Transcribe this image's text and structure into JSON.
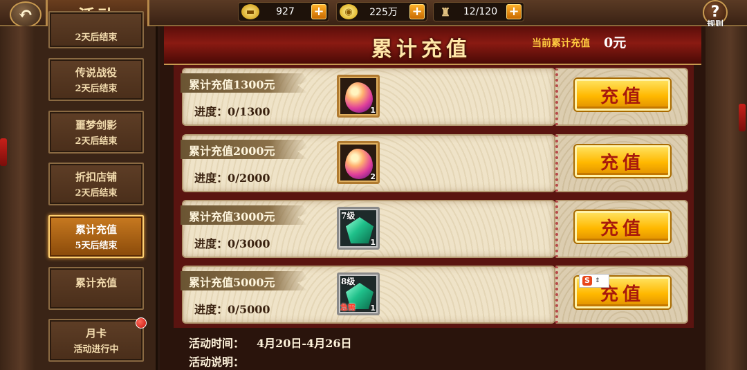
{
  "header": {
    "back_icon": "back-arrow-icon",
    "title": "活动",
    "resources": [
      {
        "name": "gold-ingot",
        "icon": "gold-ingot-icon",
        "value": "927"
      },
      {
        "name": "coin",
        "icon": "coin-icon",
        "value": "225万"
      },
      {
        "name": "stamina",
        "icon": "stamina-icon",
        "value": "12/120"
      }
    ],
    "rules_label": "规则"
  },
  "sidebar": {
    "items": [
      {
        "name": "",
        "sub": "2天后结束"
      },
      {
        "name": "传说战役",
        "sub": "2天后结束"
      },
      {
        "name": "噩梦剑影",
        "sub": "2天后结束"
      },
      {
        "name": "折扣店铺",
        "sub": "2天后结束"
      },
      {
        "name": "累计充值",
        "sub": "5天后结束",
        "active": true
      },
      {
        "name": "累计充值",
        "sub": ""
      },
      {
        "name": "月卡",
        "sub": "活动进行中",
        "badge": true
      }
    ]
  },
  "panel": {
    "title": "累计充值",
    "total_label": "当前累计充值",
    "total_value": "0元",
    "rows": [
      {
        "title": "累计充值1300元",
        "progress": "进度：0/1300",
        "reward": {
          "type": "stone",
          "count": "1"
        },
        "button": "充值"
      },
      {
        "title": "累计充值2000元",
        "progress": "进度：0/2000",
        "reward": {
          "type": "stone",
          "count": "2"
        },
        "button": "充值"
      },
      {
        "title": "累计充值3000元",
        "progress": "进度：0/3000",
        "reward": {
          "type": "gem",
          "level": "7级",
          "count": "1"
        },
        "button": "充值"
      },
      {
        "title": "累计充值5000元",
        "progress": "进度：0/5000",
        "reward": {
          "type": "gem",
          "level": "8级",
          "tag": "急需",
          "count": "1"
        },
        "button": "充值"
      }
    ],
    "time_label": "活动时间：",
    "time_value": "4月20日-4月26日",
    "desc_label": "活动说明："
  },
  "colors": {
    "button_gold": "#ffb800",
    "button_text": "#a81a0c",
    "header_red": "#8a1a12",
    "active_tab": "#c87a20"
  }
}
